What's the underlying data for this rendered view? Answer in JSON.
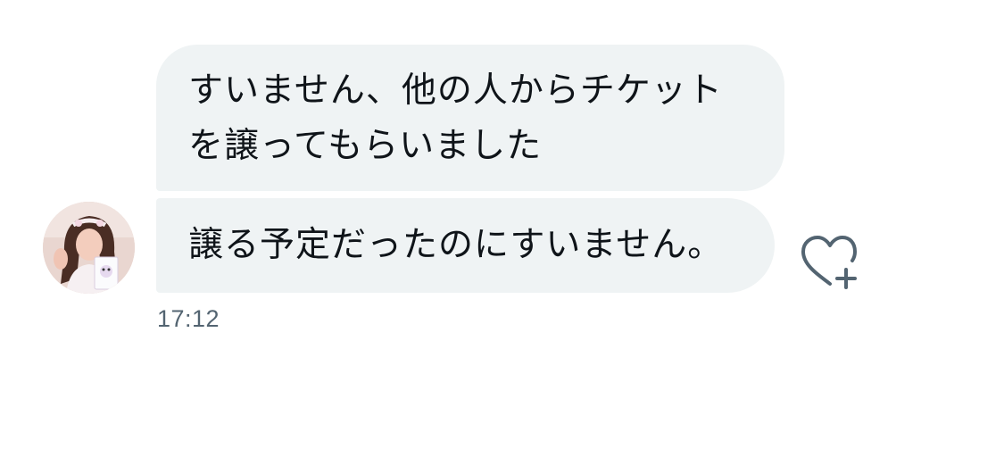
{
  "messages": [
    {
      "lines": [
        "すいません、他の人からチケット",
        "を譲ってもらいました"
      ]
    },
    {
      "lines": [
        "譲る予定だったのにすいません。"
      ]
    }
  ],
  "timestamp": "17:12",
  "icons": {
    "avatar": "avatar-photo",
    "reaction": "heart-plus-icon"
  },
  "colors": {
    "bubble_bg": "#eff3f4",
    "text": "#0f1419",
    "muted": "#536471"
  }
}
